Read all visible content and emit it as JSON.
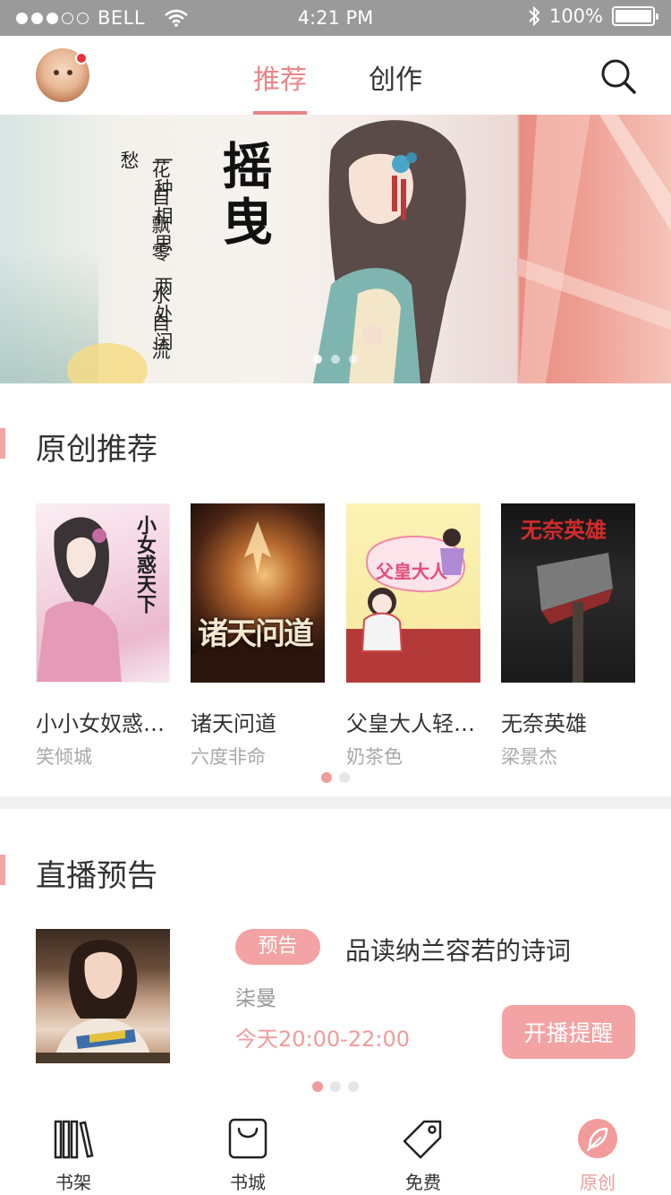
{
  "status_bar": {
    "carrier": "BELL",
    "time": "4:21 PM",
    "battery": "100%"
  },
  "header": {
    "tabs": [
      {
        "label": "推荐",
        "active": true
      },
      {
        "label": "创作",
        "active": false
      }
    ],
    "icons": {
      "avatar": "user-avatar",
      "search": "search-icon"
    }
  },
  "banner": {
    "title": "摇曳",
    "poem_lines": [
      "一种相思 两处闲愁",
      "花自飘零 水自流"
    ],
    "pages": 3,
    "current_page": 1
  },
  "original_section": {
    "title": "原创推荐",
    "books": [
      {
        "title": "小小女奴惑…",
        "author": "笑倾城"
      },
      {
        "title": "诸天问道",
        "author": "六度非命"
      },
      {
        "title": "父皇大人轻…",
        "author": "奶茶色"
      },
      {
        "title": "无奈英雄",
        "author": "梁景杰"
      }
    ],
    "pages": 2,
    "current_page": 1
  },
  "live_section": {
    "title": "直播预告",
    "badge": "预告",
    "live_title": "品读纳兰容若的诗词",
    "host": "柒曼",
    "time": "今天20:00-22:00",
    "remind_label": "开播提醒",
    "pages": 3,
    "current_page": 1
  },
  "bottom_nav": {
    "items": [
      {
        "label": "书架",
        "icon": "bookshelf-icon",
        "active": false
      },
      {
        "label": "书城",
        "icon": "shopping-bag-icon",
        "active": false
      },
      {
        "label": "免费",
        "icon": "tag-icon",
        "active": false
      },
      {
        "label": "原创",
        "icon": "leaf-icon",
        "active": true
      }
    ]
  },
  "colors": {
    "accent": "#f19b9b",
    "status_bar": "#9a9a9a",
    "text": "#333333",
    "muted": "#a8a8a8"
  }
}
